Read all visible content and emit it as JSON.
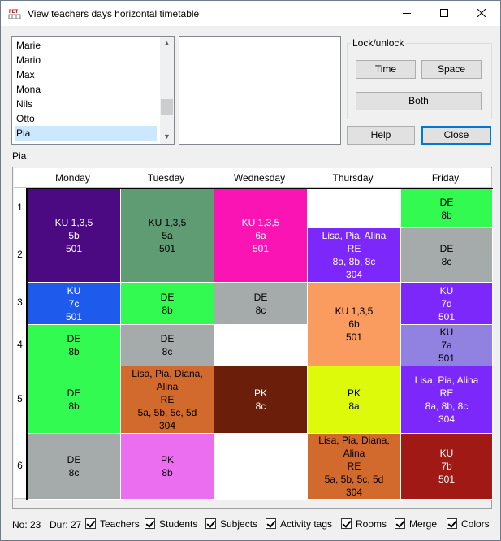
{
  "window": {
    "title": "View teachers days horizontal timetable"
  },
  "teacher_list": {
    "items": [
      "Marie",
      "Mario",
      "Max",
      "Mona",
      "Nils",
      "Otto",
      "Pia"
    ],
    "selected": "Pia"
  },
  "lock_unlock": {
    "label": "Lock/unlock",
    "time": "Time",
    "space": "Space",
    "both": "Both"
  },
  "buttons": {
    "help": "Help",
    "close": "Close"
  },
  "current_teacher": "Pia",
  "timetable": {
    "days": [
      "Monday",
      "Tuesday",
      "Wednesday",
      "Thursday",
      "Friday"
    ],
    "hours": [
      "1",
      "2",
      "3",
      "4",
      "5",
      "6"
    ],
    "cells": [
      {
        "day": 0,
        "start": 0,
        "span": 2,
        "color": "#4b0a82",
        "text_color": "#ffffff",
        "lines": [
          "KU 1,3,5",
          "5b",
          "501"
        ]
      },
      {
        "day": 1,
        "start": 0,
        "span": 2,
        "color": "#5f9b73",
        "text_color": "#000000",
        "lines": [
          "KU 1,3,5",
          "5a",
          "501"
        ]
      },
      {
        "day": 2,
        "start": 0,
        "span": 2,
        "color": "#fa14b4",
        "text_color": "#ffffff",
        "lines": [
          "KU 1,3,5",
          "6a",
          "501"
        ]
      },
      {
        "day": 3,
        "start": 0,
        "span": 1,
        "color": "#ffffff",
        "text_color": "#000000",
        "lines": []
      },
      {
        "day": 4,
        "start": 0,
        "span": 1,
        "color": "#32fa50",
        "text_color": "#000000",
        "lines": [
          "DE",
          "8b"
        ]
      },
      {
        "day": 3,
        "start": 1,
        "span": 1,
        "color": "#7d28fa",
        "text_color": "#ffffff",
        "lines": [
          "Lisa, Pia, Alina",
          "RE",
          "8a, 8b, 8c",
          "304"
        ]
      },
      {
        "day": 4,
        "start": 1,
        "span": 1,
        "color": "#a5aaaa",
        "text_color": "#000000",
        "lines": [
          "DE",
          "8c"
        ]
      },
      {
        "day": 0,
        "start": 2,
        "span": 1,
        "color": "#1e5aeb",
        "text_color": "#ffffff",
        "lines": [
          "KU",
          "7c",
          "501"
        ]
      },
      {
        "day": 1,
        "start": 2,
        "span": 1,
        "color": "#32fa50",
        "text_color": "#000000",
        "lines": [
          "DE",
          "8b"
        ]
      },
      {
        "day": 2,
        "start": 2,
        "span": 1,
        "color": "#a5aaaa",
        "text_color": "#000000",
        "lines": [
          "DE",
          "8c"
        ]
      },
      {
        "day": 3,
        "start": 2,
        "span": 2,
        "color": "#fa9b5f",
        "text_color": "#000000",
        "lines": [
          "KU 1,3,5",
          "6b",
          "501"
        ]
      },
      {
        "day": 4,
        "start": 2,
        "span": 1,
        "color": "#7d28fa",
        "text_color": "#ffffff",
        "lines": [
          "KU",
          "7d",
          "501"
        ]
      },
      {
        "day": 0,
        "start": 3,
        "span": 1,
        "color": "#32fa50",
        "text_color": "#000000",
        "lines": [
          "DE",
          "8b"
        ]
      },
      {
        "day": 1,
        "start": 3,
        "span": 1,
        "color": "#a5aaaa",
        "text_color": "#000000",
        "lines": [
          "DE",
          "8c"
        ]
      },
      {
        "day": 2,
        "start": 3,
        "span": 1,
        "color": "#ffffff",
        "text_color": "#000000",
        "lines": []
      },
      {
        "day": 4,
        "start": 3,
        "span": 1,
        "color": "#9182e1",
        "text_color": "#000000",
        "lines": [
          "KU",
          "7a",
          "501"
        ]
      },
      {
        "day": 0,
        "start": 4,
        "span": 1,
        "color": "#32fa50",
        "text_color": "#000000",
        "lines": [
          "DE",
          "8b"
        ]
      },
      {
        "day": 1,
        "start": 4,
        "span": 1,
        "color": "#d2692d",
        "text_color": "#000000",
        "lines": [
          "Lisa, Pia, Diana,",
          "Alina",
          "RE",
          "5a, 5b, 5c, 5d",
          "304"
        ]
      },
      {
        "day": 2,
        "start": 4,
        "span": 1,
        "color": "#6b1e0a",
        "text_color": "#ffffff",
        "lines": [
          "PK",
          "8c"
        ]
      },
      {
        "day": 3,
        "start": 4,
        "span": 1,
        "color": "#dcfa0a",
        "text_color": "#000000",
        "lines": [
          "PK",
          "8a"
        ]
      },
      {
        "day": 4,
        "start": 4,
        "span": 1,
        "color": "#7d28fa",
        "text_color": "#ffffff",
        "lines": [
          "Lisa, Pia, Alina",
          "RE",
          "8a, 8b, 8c",
          "304"
        ]
      },
      {
        "day": 0,
        "start": 5,
        "span": 1,
        "color": "#a5aaaa",
        "text_color": "#000000",
        "lines": [
          "DE",
          "8c"
        ]
      },
      {
        "day": 1,
        "start": 5,
        "span": 1,
        "color": "#eb6ef0",
        "text_color": "#000000",
        "lines": [
          "PK",
          "8b"
        ]
      },
      {
        "day": 2,
        "start": 5,
        "span": 1,
        "color": "#ffffff",
        "text_color": "#000000",
        "lines": []
      },
      {
        "day": 3,
        "start": 5,
        "span": 1,
        "color": "#d2692d",
        "text_color": "#000000",
        "lines": [
          "Lisa, Pia, Diana,",
          "Alina",
          "RE",
          "5a, 5b, 5c, 5d",
          "304"
        ]
      },
      {
        "day": 4,
        "start": 5,
        "span": 1,
        "color": "#a01914",
        "text_color": "#ffffff",
        "lines": [
          "KU",
          "7b",
          "501"
        ]
      }
    ]
  },
  "status": {
    "no": "No: 23",
    "dur": "Dur: 27"
  },
  "checkboxes": [
    {
      "label": "Teachers",
      "checked": true
    },
    {
      "label": "Students",
      "checked": true
    },
    {
      "label": "Subjects",
      "checked": true
    },
    {
      "label": "Activity tags",
      "checked": true
    },
    {
      "label": "Rooms",
      "checked": true
    },
    {
      "label": "Merge",
      "checked": true
    },
    {
      "label": "Colors",
      "checked": true
    }
  ]
}
